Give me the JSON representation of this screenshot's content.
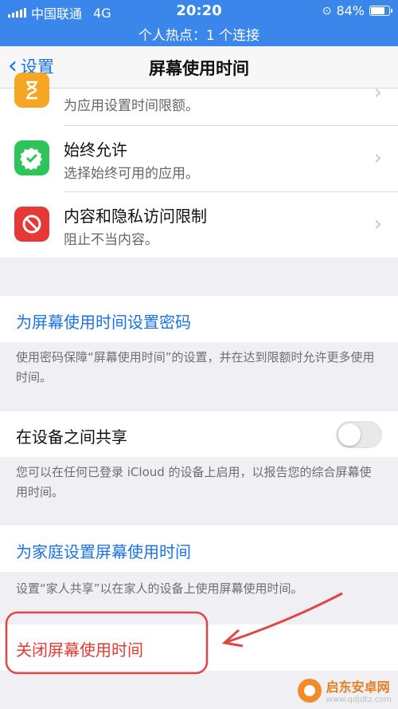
{
  "status_bar": {
    "carrier": "中国联通",
    "network": "4G",
    "time": "20:20",
    "battery": "84%",
    "battery_level": 0.84,
    "hotspot": "个人热点：1 个连接"
  },
  "nav": {
    "back_label": "设置",
    "title": "屏幕使用时间"
  },
  "rows": [
    {
      "title": "",
      "subtitle": "为应用设置时间限额。",
      "icon": "hourglass-icon",
      "color": "#f5a623"
    },
    {
      "title": "始终允许",
      "subtitle": "选择始终可用的应用。",
      "icon": "checkmark-badge-icon",
      "color": "#2fc45a"
    },
    {
      "title": "内容和隐私访问限制",
      "subtitle": "阻止不当内容。",
      "icon": "restriction-icon",
      "color": "#e53935"
    }
  ],
  "passcode": {
    "label": "为屏幕使用时间设置密码",
    "footer": "使用密码保障“屏幕使用时间”的设置，并在达到限额时允许更多使用时间。"
  },
  "share": {
    "label": "在设备之间共享",
    "enabled": false,
    "footer": "您可以在任何已登录 iCloud 的设备上启用，以报告您的综合屏幕使用时间。"
  },
  "family": {
    "label": "为家庭设置屏幕使用时间",
    "footer": "设置“家人共享”以在家人的设备上使用屏幕使用时间。"
  },
  "turn_off": {
    "label": "关闭屏幕使用时间"
  },
  "watermark": {
    "name": "启东安卓网",
    "url": "www.qdjdtz.com"
  },
  "colors": {
    "accent": "#1a73e8",
    "statusbar": "#3a86ea",
    "destructive": "#e53935",
    "annotation": "#e04646"
  }
}
